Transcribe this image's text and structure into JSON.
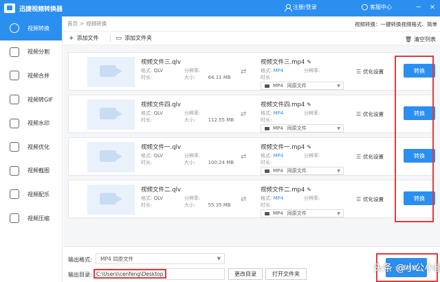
{
  "app": {
    "title": "迅捷视频转换器",
    "login_label": "注册/登录",
    "service_label": "客服中心"
  },
  "window": {
    "minimize": "−",
    "close": "×"
  },
  "sidebar": {
    "items": [
      {
        "label": "视频转换",
        "icon": "convert-icon",
        "active": true
      },
      {
        "label": "视频分割",
        "icon": "split-icon"
      },
      {
        "label": "视频合并",
        "icon": "merge-icon"
      },
      {
        "label": "视频转GIF",
        "icon": "gif-icon"
      },
      {
        "label": "视频水印",
        "icon": "watermark-icon"
      },
      {
        "label": "视频优化",
        "icon": "optimize-icon"
      },
      {
        "label": "视频截图",
        "icon": "screenshot-icon"
      },
      {
        "label": "视频配乐",
        "icon": "music-icon"
      },
      {
        "label": "视频压缩",
        "icon": "compress-icon"
      }
    ]
  },
  "breadcrumb": {
    "home": "首页",
    "sep": ">",
    "current": "视频转换"
  },
  "description": "视频转换：一键转换视频格式、简单",
  "toolbar": {
    "add_file": "添加文件",
    "add_folder": "添加文件夹",
    "clear": "清空列表"
  },
  "labels": {
    "format": "格式:",
    "duration": "时长:",
    "resolution": "分辨率:",
    "size": "大小:",
    "optimize": "优化设置",
    "convert": "转换",
    "quality": "同原文件"
  },
  "files": [
    {
      "src": "视频文件三.qlv",
      "src_format": "QLV",
      "src_size": "64.11 MB",
      "dst": "视频文件三.mp4",
      "dst_format": "MP4",
      "sel_format": "MP4"
    },
    {
      "src": "视频文件四.qlv",
      "src_format": "QLV",
      "src_size": "112.55 MB",
      "dst": "视频文件四.mp4",
      "dst_format": "MP4",
      "sel_format": "MP4"
    },
    {
      "src": "视频文件一.qlv",
      "src_format": "QLV",
      "src_size": "100.24 MB",
      "dst": "视频文件一.mp4",
      "dst_format": "MP4",
      "sel_format": "MP4"
    },
    {
      "src": "视频文件二.qlv",
      "src_format": "QLV",
      "src_size": "55.35 MB",
      "dst": "视频文件二.mp4",
      "dst_format": "MP4",
      "sel_format": "MP4"
    }
  ],
  "bottom": {
    "output_format_label": "输出格式:",
    "output_format_value": "MP4   同原文件",
    "output_dir_label": "输出目录:",
    "output_dir_value": "C:\\Users\\cenfeng\\Desktop",
    "change_dir": "更改目录",
    "open_folder": "打开文件夹",
    "convert_all": "全部转换"
  },
  "watermark": "头条 @小公小能手"
}
